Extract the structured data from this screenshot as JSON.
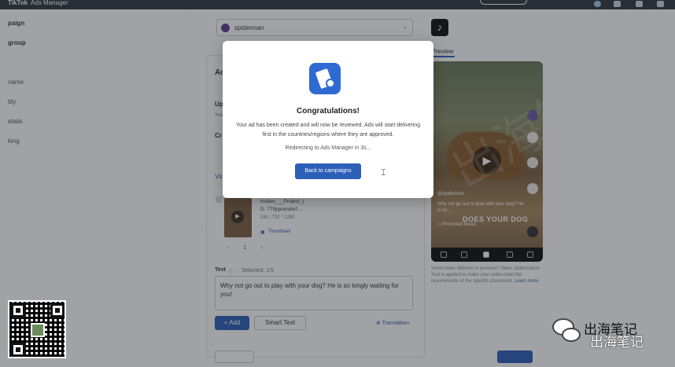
{
  "topbar": {
    "brand": "TikTok",
    "brand_sub": "Ads Manager"
  },
  "sidebar": {
    "items": [
      {
        "label": "paign",
        "bold": true
      },
      {
        "label": "group",
        "bold": true
      },
      {
        "label": "name",
        "bold": false
      },
      {
        "label": "tity",
        "bold": false
      },
      {
        "label": "etails",
        "bold": false
      },
      {
        "label": "king",
        "bold": false
      }
    ]
  },
  "identity_dropdown": {
    "value": "spiderman"
  },
  "form": {
    "section_title": "Ac",
    "upload_label": "Up",
    "upload_hint": "You",
    "create_label": "Cr",
    "video_tab": "Vide",
    "video_item": {
      "name_line1": "kvideo___Project_(",
      "name_line2": "D.  779pprenderf...",
      "meta": "18s | 720 * 1280",
      "thumbnail_link": "Thumbnail"
    },
    "pager": {
      "prev": "‹",
      "page": "1",
      "next": "›"
    },
    "text_label": "Text",
    "text_info": "ⓘ",
    "selected_label": "Selected: 1/5",
    "text_value": "Why not go out to play with your dog? He is so longly waiting for you!",
    "add_button": "+ Add",
    "smart_text_button": "Smart Text",
    "translation_link": "Translation"
  },
  "preview": {
    "label": "Preview",
    "phone": {
      "handle": "@spiderman",
      "caption": "Why not go out to play with your dog? He is so...",
      "overlay_text": "DOES YOUR DOG",
      "promoted": "♫ Promoted Music"
    },
    "note_prefix": "Video looks different in preview? Video Optimization Tool is applied to make your video meet the requirements of the specific placement.",
    "note_link": "Learn more"
  },
  "modal": {
    "title": "Congratulations!",
    "body": "Your ad has been created and will now be reviewed. Ads will start delivering first in the countries/regions where they are approved.",
    "redirect": "Redirecting to Ads Manager in 3s...",
    "button": "Back to campaigns"
  },
  "watermark": {
    "text": "出海笔记"
  },
  "wechat_badge": {
    "name": "出海笔记"
  }
}
